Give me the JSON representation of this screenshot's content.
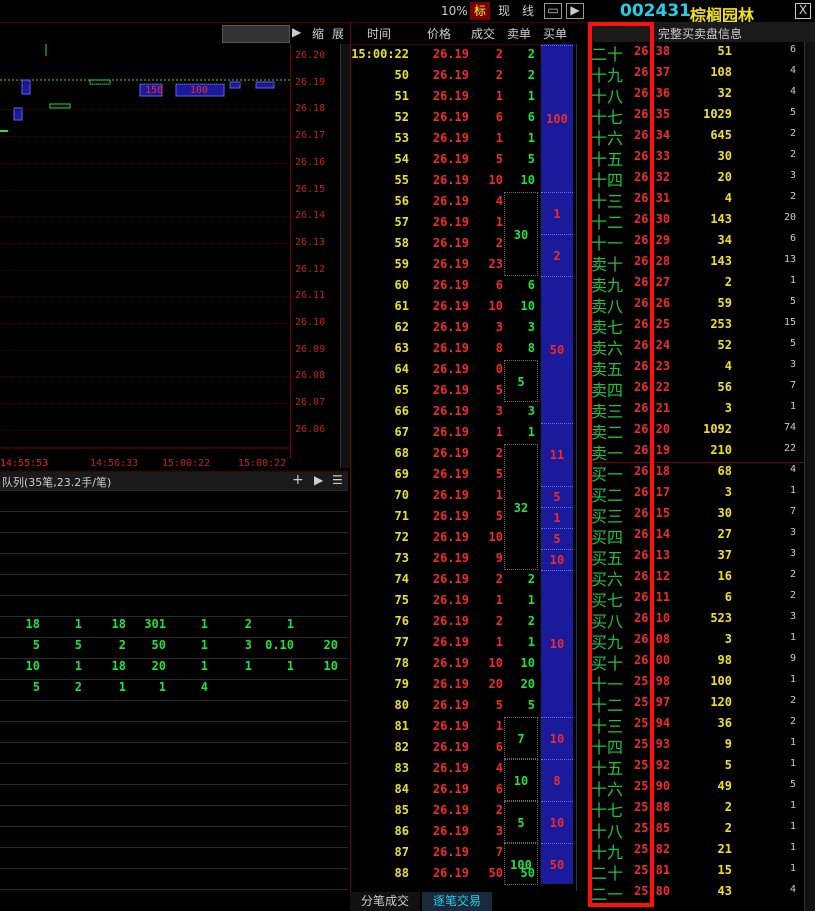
{
  "topbar": {
    "buttons": [
      "10%",
      "标",
      "现",
      "线"
    ],
    "code": "002431",
    "name": "棕榈园林",
    "close": "X"
  },
  "chart_toolbar": {
    "play": "▶",
    "shrink": "缩",
    "expand": "展"
  },
  "chart": {
    "y_ticks": [
      "26.20",
      "26.19",
      "26.18",
      "26.17",
      "26.16",
      "26.15",
      "26.14",
      "26.13",
      "26.12",
      "26.11",
      "26.10",
      "26.09",
      "26.08",
      "26.07",
      "26.06"
    ],
    "x_ticks": [
      "14:55:53",
      "14:56:33",
      "15:00:22",
      "15:00:22"
    ],
    "labels": [
      "150",
      "100"
    ]
  },
  "queue": {
    "title": "队列(35笔,23.2手/笔)",
    "rows": [
      [
        "18",
        "1",
        "18",
        "301",
        "1",
        "2",
        "1",
        ""
      ],
      [
        "5",
        "5",
        "2",
        "50",
        "1",
        "3",
        "0.10",
        "20"
      ],
      [
        "10",
        "1",
        "18",
        "20",
        "1",
        "1",
        "1",
        "10"
      ],
      [
        "5",
        "2",
        "1",
        "1",
        "4",
        "",
        "",
        ""
      ]
    ]
  },
  "ticks": {
    "headers": [
      "时间",
      "价格",
      "成交",
      "卖单",
      "买单"
    ],
    "rows": [
      {
        "t": "15:00:22",
        "p": "26.19",
        "v": "2",
        "s": "2"
      },
      {
        "t": "50",
        "p": "26.19",
        "v": "2",
        "s": "2"
      },
      {
        "t": "51",
        "p": "26.19",
        "v": "1",
        "s": "1"
      },
      {
        "t": "52",
        "p": "26.19",
        "v": "6",
        "s": "6"
      },
      {
        "t": "53",
        "p": "26.19",
        "v": "1",
        "s": "1"
      },
      {
        "t": "54",
        "p": "26.19",
        "v": "5",
        "s": "5"
      },
      {
        "t": "55",
        "p": "26.19",
        "v": "10",
        "s": "10"
      },
      {
        "t": "56",
        "p": "26.19",
        "v": "4",
        "s": ""
      },
      {
        "t": "57",
        "p": "26.19",
        "v": "1",
        "s": ""
      },
      {
        "t": "58",
        "p": "26.19",
        "v": "2",
        "s": ""
      },
      {
        "t": "59",
        "p": "26.19",
        "v": "23",
        "s": ""
      },
      {
        "t": "60",
        "p": "26.19",
        "v": "6",
        "s": "6"
      },
      {
        "t": "61",
        "p": "26.19",
        "v": "10",
        "s": "10"
      },
      {
        "t": "62",
        "p": "26.19",
        "v": "3",
        "s": "3"
      },
      {
        "t": "63",
        "p": "26.19",
        "v": "8",
        "s": "8"
      },
      {
        "t": "64",
        "p": "26.19",
        "v": "0",
        "s": ""
      },
      {
        "t": "65",
        "p": "26.19",
        "v": "5",
        "s": ""
      },
      {
        "t": "66",
        "p": "26.19",
        "v": "3",
        "s": "3"
      },
      {
        "t": "67",
        "p": "26.19",
        "v": "1",
        "s": "1"
      },
      {
        "t": "68",
        "p": "26.19",
        "v": "2",
        "s": ""
      },
      {
        "t": "69",
        "p": "26.19",
        "v": "5",
        "s": ""
      },
      {
        "t": "70",
        "p": "26.19",
        "v": "1",
        "s": ""
      },
      {
        "t": "71",
        "p": "26.19",
        "v": "5",
        "s": ""
      },
      {
        "t": "72",
        "p": "26.19",
        "v": "10",
        "s": ""
      },
      {
        "t": "73",
        "p": "26.19",
        "v": "9",
        "s": ""
      },
      {
        "t": "74",
        "p": "26.19",
        "v": "2",
        "s": "2"
      },
      {
        "t": "75",
        "p": "26.19",
        "v": "1",
        "s": "1"
      },
      {
        "t": "76",
        "p": "26.19",
        "v": "2",
        "s": "2"
      },
      {
        "t": "77",
        "p": "26.19",
        "v": "1",
        "s": "1"
      },
      {
        "t": "78",
        "p": "26.19",
        "v": "10",
        "s": "10"
      },
      {
        "t": "79",
        "p": "26.19",
        "v": "20",
        "s": "20"
      },
      {
        "t": "80",
        "p": "26.19",
        "v": "5",
        "s": "5"
      },
      {
        "t": "81",
        "p": "26.19",
        "v": "1",
        "s": ""
      },
      {
        "t": "82",
        "p": "26.19",
        "v": "6",
        "s": ""
      },
      {
        "t": "83",
        "p": "26.19",
        "v": "4",
        "s": ""
      },
      {
        "t": "84",
        "p": "26.19",
        "v": "6",
        "s": ""
      },
      {
        "t": "85",
        "p": "26.19",
        "v": "2",
        "s": ""
      },
      {
        "t": "86",
        "p": "26.19",
        "v": "3",
        "s": ""
      },
      {
        "t": "87",
        "p": "26.19",
        "v": "7",
        "s": ""
      },
      {
        "t": "88",
        "p": "26.19",
        "v": "50",
        "s": "50"
      }
    ],
    "sell_groups": [
      {
        "label": "30",
        "start": 7,
        "span": 4
      },
      {
        "label": "5",
        "start": 15,
        "span": 2
      },
      {
        "label": "32",
        "start": 19,
        "span": 6
      },
      {
        "label": "7",
        "start": 32,
        "span": 2
      },
      {
        "label": "10",
        "start": 34,
        "span": 2
      },
      {
        "label": "5",
        "start": 36,
        "span": 2
      },
      {
        "label": "100",
        "start": 38,
        "span": 2
      }
    ],
    "buy_blocks": [
      {
        "label": "100",
        "start": 0,
        "span": 7
      },
      {
        "label": "1",
        "start": 7,
        "span": 2
      },
      {
        "label": "2",
        "start": 9,
        "span": 2
      },
      {
        "label": "50",
        "start": 11,
        "span": 7
      },
      {
        "label": "11",
        "start": 18,
        "span": 3
      },
      {
        "label": "5",
        "start": 21,
        "span": 1
      },
      {
        "label": "1",
        "start": 22,
        "span": 1
      },
      {
        "label": "5",
        "start": 23,
        "span": 1
      },
      {
        "label": "10",
        "start": 24,
        "span": 1
      },
      {
        "label": "10",
        "start": 25,
        "span": 7
      },
      {
        "label": "10",
        "start": 32,
        "span": 2
      },
      {
        "label": "8",
        "start": 34,
        "span": 2
      },
      {
        "label": "10",
        "start": 36,
        "span": 2
      },
      {
        "label": "50",
        "start": 38,
        "span": 2
      }
    ],
    "tabs": [
      "分笔成交",
      "逐笔交易"
    ]
  },
  "depth": {
    "title": "完整买卖盘信息",
    "sell": [
      {
        "l": "二十",
        "p": "26.38",
        "v": "51",
        "c": "6"
      },
      {
        "l": "十九",
        "p": "26.37",
        "v": "108",
        "c": "4"
      },
      {
        "l": "十八",
        "p": "26.36",
        "v": "32",
        "c": "4"
      },
      {
        "l": "十七",
        "p": "26.35",
        "v": "1029",
        "c": "5"
      },
      {
        "l": "十六",
        "p": "26.34",
        "v": "645",
        "c": "2"
      },
      {
        "l": "十五",
        "p": "26.33",
        "v": "30",
        "c": "2"
      },
      {
        "l": "十四",
        "p": "26.32",
        "v": "20",
        "c": "3"
      },
      {
        "l": "十三",
        "p": "26.31",
        "v": "4",
        "c": "2"
      },
      {
        "l": "十二",
        "p": "26.30",
        "v": "143",
        "c": "20"
      },
      {
        "l": "十一",
        "p": "26.29",
        "v": "34",
        "c": "6"
      },
      {
        "l": "卖十",
        "p": "26.28",
        "v": "143",
        "c": "13"
      },
      {
        "l": "卖九",
        "p": "26.27",
        "v": "2",
        "c": "1"
      },
      {
        "l": "卖八",
        "p": "26.26",
        "v": "59",
        "c": "5"
      },
      {
        "l": "卖七",
        "p": "26.25",
        "v": "253",
        "c": "15"
      },
      {
        "l": "卖六",
        "p": "26.24",
        "v": "52",
        "c": "5"
      },
      {
        "l": "卖五",
        "p": "26.23",
        "v": "4",
        "c": "3"
      },
      {
        "l": "卖四",
        "p": "26.22",
        "v": "56",
        "c": "7"
      },
      {
        "l": "卖三",
        "p": "26.21",
        "v": "3",
        "c": "1"
      },
      {
        "l": "卖二",
        "p": "26.20",
        "v": "1092",
        "c": "74"
      },
      {
        "l": "卖一",
        "p": "26.19",
        "v": "210",
        "c": "22"
      }
    ],
    "buy": [
      {
        "l": "买一",
        "p": "26.18",
        "v": "68",
        "c": "4"
      },
      {
        "l": "买二",
        "p": "26.17",
        "v": "3",
        "c": "1"
      },
      {
        "l": "买三",
        "p": "26.15",
        "v": "30",
        "c": "7"
      },
      {
        "l": "买四",
        "p": "26.14",
        "v": "27",
        "c": "3"
      },
      {
        "l": "买五",
        "p": "26.13",
        "v": "37",
        "c": "3"
      },
      {
        "l": "买六",
        "p": "26.12",
        "v": "16",
        "c": "2"
      },
      {
        "l": "买七",
        "p": "26.11",
        "v": "6",
        "c": "2"
      },
      {
        "l": "买八",
        "p": "26.10",
        "v": "523",
        "c": "3"
      },
      {
        "l": "买九",
        "p": "26.08",
        "v": "3",
        "c": "1"
      },
      {
        "l": "买十",
        "p": "26.00",
        "v": "98",
        "c": "9"
      },
      {
        "l": "十一",
        "p": "25.98",
        "v": "100",
        "c": "1"
      },
      {
        "l": "十二",
        "p": "25.97",
        "v": "120",
        "c": "2"
      },
      {
        "l": "十三",
        "p": "25.94",
        "v": "36",
        "c": "2"
      },
      {
        "l": "十四",
        "p": "25.93",
        "v": "9",
        "c": "1"
      },
      {
        "l": "十五",
        "p": "25.92",
        "v": "5",
        "c": "1"
      },
      {
        "l": "十六",
        "p": "25.90",
        "v": "49",
        "c": "5"
      },
      {
        "l": "十七",
        "p": "25.88",
        "v": "2",
        "c": "1"
      },
      {
        "l": "十八",
        "p": "25.85",
        "v": "2",
        "c": "1"
      },
      {
        "l": "十九",
        "p": "25.82",
        "v": "21",
        "c": "1"
      },
      {
        "l": "二十",
        "p": "25.81",
        "v": "15",
        "c": "1"
      },
      {
        "l": "二一",
        "p": "25.80",
        "v": "43",
        "c": "4"
      }
    ]
  },
  "colors": {
    "up": "#ee2b2b",
    "down": "#20e040",
    "accent": "#1a1a9a",
    "highlight": "#ff1010"
  }
}
